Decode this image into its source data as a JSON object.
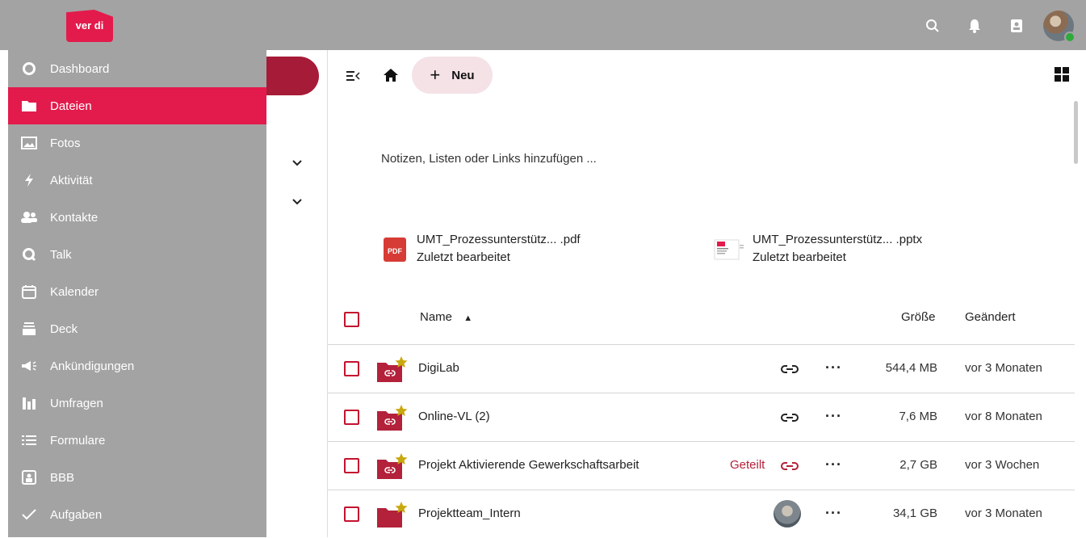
{
  "header": {
    "logo_text": "ver di",
    "icons": [
      "search-icon",
      "bell-icon",
      "contacts-icon",
      "avatar"
    ]
  },
  "nav": {
    "items": [
      {
        "label": "Dashboard",
        "icon": "dashboard-icon"
      },
      {
        "label": "Dateien",
        "icon": "folder-icon",
        "active": true
      },
      {
        "label": "Fotos",
        "icon": "image-icon"
      },
      {
        "label": "Aktivität",
        "icon": "lightning-icon"
      },
      {
        "label": "Kontakte",
        "icon": "people-icon"
      },
      {
        "label": "Talk",
        "icon": "talk-icon"
      },
      {
        "label": "Kalender",
        "icon": "calendar-icon"
      },
      {
        "label": "Deck",
        "icon": "deck-icon"
      },
      {
        "label": "Ankündigungen",
        "icon": "megaphone-icon"
      },
      {
        "label": "Umfragen",
        "icon": "poll-icon"
      },
      {
        "label": "Formulare",
        "icon": "list-icon"
      },
      {
        "label": "BBB",
        "icon": "bbb-icon"
      },
      {
        "label": "Aufgaben",
        "icon": "check-icon"
      }
    ]
  },
  "toolbar": {
    "new_label": "Neu"
  },
  "notes_placeholder": "Notizen, Listen oder Links hinzufügen ...",
  "recent": [
    {
      "name": "UMT_Prozessunterstütz... .pdf",
      "sub": "Zuletzt bearbeitet",
      "type": "pdf"
    },
    {
      "name": "UMT_Prozessunterstütz... .pptx",
      "sub": "Zuletzt bearbeitet",
      "type": "pptx"
    }
  ],
  "table": {
    "col_name": "Name",
    "col_size": "Größe",
    "col_modified": "Geändert",
    "rows": [
      {
        "name": "DigiLab",
        "shared": "",
        "size": "544,4 MB",
        "modified": "vor 3 Monaten",
        "link": true
      },
      {
        "name": "Online-VL (2)",
        "shared": "",
        "size": "7,6 MB",
        "modified": "vor 8 Monaten",
        "link": true
      },
      {
        "name": "Projekt Aktivierende Gewerkschaftsarbeit",
        "shared": "Geteilt",
        "size": "2,7 GB",
        "modified": "vor 3 Wochen",
        "link": true
      },
      {
        "name": "Projektteam_Intern",
        "shared": "",
        "size": "34,1 GB",
        "modified": "vor 3 Monaten",
        "link": false
      }
    ]
  },
  "colors": {
    "accent": "#e31b4c",
    "folder": "#b3213a",
    "star": "#c9a80f",
    "nav_bg": "#a3a3a3"
  }
}
